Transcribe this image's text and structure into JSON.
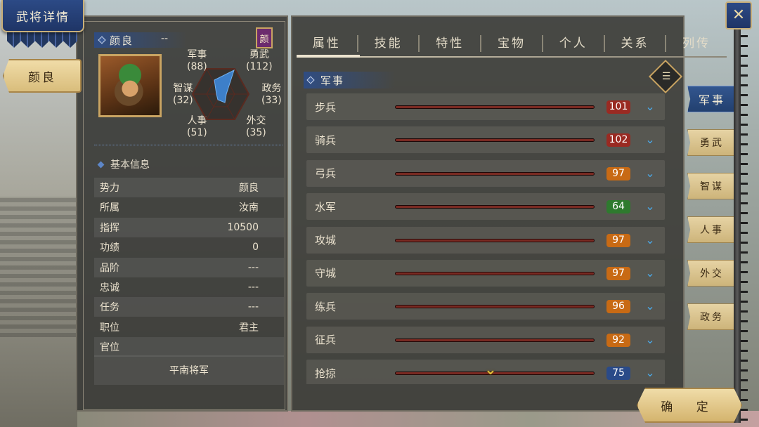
{
  "header": {
    "title": "武将详情",
    "close_icon": "crossed-swords-icon"
  },
  "hero": {
    "tab_name": "颜良",
    "name": "颜良",
    "title": "--",
    "seal": "颜",
    "portrait": "general-portrait"
  },
  "stats": {
    "military": {
      "label": "军事",
      "value": "(88)"
    },
    "valor": {
      "label": "勇武",
      "value": "(112)"
    },
    "strategy": {
      "label": "智谋",
      "value": "(32)"
    },
    "politics": {
      "label": "政务",
      "value": "(33)"
    },
    "personnel": {
      "label": "人事",
      "value": "(51)"
    },
    "diplomacy": {
      "label": "外交",
      "value": "(35)"
    }
  },
  "basic_info": {
    "title": "基本信息",
    "rows": [
      {
        "label": "势力",
        "value": "颜良"
      },
      {
        "label": "所属",
        "value": "汝南"
      },
      {
        "label": "指挥",
        "value": "10500"
      },
      {
        "label": "功绩",
        "value": "0"
      },
      {
        "label": "品阶",
        "value": "---"
      },
      {
        "label": "忠诚",
        "value": "---"
      },
      {
        "label": "任务",
        "value": "---"
      },
      {
        "label": "职位",
        "value": "君主"
      },
      {
        "label": "官位",
        "value": ""
      }
    ],
    "rank_title": "平南将军"
  },
  "tabs": [
    "属性",
    "技能",
    "特性",
    "宝物",
    "个人",
    "关系",
    "列传"
  ],
  "active_tab": "属性",
  "category": {
    "title": "军事",
    "list_icon": "list-icon"
  },
  "skills": [
    {
      "name": "步兵",
      "value": "101",
      "fill": 1.0,
      "color": "#9a2a22"
    },
    {
      "name": "骑兵",
      "value": "102",
      "fill": 1.0,
      "color": "#9a2a22"
    },
    {
      "name": "弓兵",
      "value": "97",
      "fill": 1.0,
      "color": "#c86a14"
    },
    {
      "name": "水军",
      "value": "64",
      "fill": 1.0,
      "color": "#2e7a2e"
    },
    {
      "name": "攻城",
      "value": "97",
      "fill": 1.0,
      "color": "#c86a14"
    },
    {
      "name": "守城",
      "value": "97",
      "fill": 1.0,
      "color": "#c86a14"
    },
    {
      "name": "练兵",
      "value": "96",
      "fill": 1.0,
      "color": "#c86a14"
    },
    {
      "name": "征兵",
      "value": "92",
      "fill": 1.0,
      "color": "#c86a14"
    },
    {
      "name": "抢掠",
      "value": "75",
      "fill": 1.0,
      "color": "#2a4a88"
    }
  ],
  "side_tabs": [
    "军事",
    "勇武",
    "智谋",
    "人事",
    "外交",
    "政务"
  ],
  "active_side_tab": "军事",
  "confirm_label": "确 定"
}
